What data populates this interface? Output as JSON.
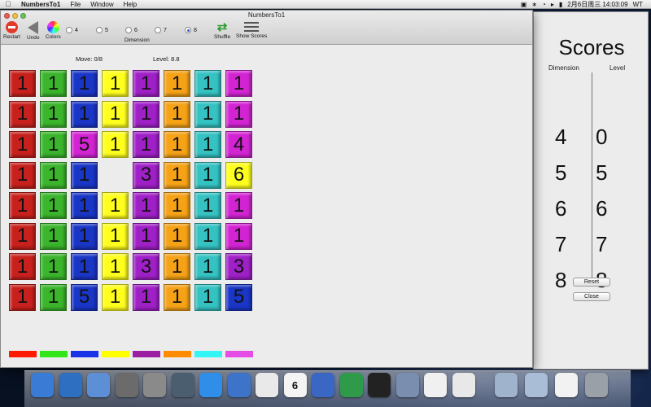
{
  "menubar": {
    "app_name": "NumbersTo1",
    "menus": [
      "File",
      "Window",
      "Help"
    ],
    "clock": "2月6日周三  14:03:09",
    "user": "WT"
  },
  "window": {
    "title": "NumbersTo1",
    "toolbar": {
      "restart": "Restart",
      "undo": "Undo",
      "colors": "Colors",
      "dimension_label": "Dimension",
      "shuffle": "Shuffle",
      "show_scores": "Show Scores",
      "dimension_options": [
        "4",
        "5",
        "6",
        "7",
        "8"
      ],
      "selected_dimension": "8"
    },
    "status": {
      "move": "Move: 0/8",
      "level": "Level: 8.8"
    },
    "board": {
      "column_colors": [
        "#c8211d",
        "#3bb52c",
        "#1a36c7",
        "#ffff1e",
        "#a020c8",
        "#f5a217",
        "#35c2c2",
        "#d324d3"
      ],
      "rows": [
        [
          "1",
          "1",
          "1",
          "1",
          "1",
          "1",
          "1",
          "1"
        ],
        [
          "1",
          "1",
          "1",
          "1",
          "1",
          "1",
          "1",
          "1"
        ],
        [
          "1",
          "1",
          "5",
          "1",
          "1",
          "1",
          "1",
          "4"
        ],
        [
          "1",
          "1",
          "1",
          "",
          "3",
          "1",
          "1",
          "6"
        ],
        [
          "1",
          "1",
          "1",
          "1",
          "1",
          "1",
          "1",
          "1"
        ],
        [
          "1",
          "1",
          "1",
          "1",
          "1",
          "1",
          "1",
          "1"
        ],
        [
          "1",
          "1",
          "1",
          "1",
          "3",
          "1",
          "1",
          "3"
        ],
        [
          "1",
          "1",
          "5",
          "1",
          "1",
          "1",
          "1",
          "5"
        ]
      ],
      "cell_colors": [
        [
          "#c8211d",
          "#3bb52c",
          "#1a36c7",
          "#ffff1e",
          "#a020c8",
          "#f5a217",
          "#35c2c2",
          "#d324d3"
        ],
        [
          "#c8211d",
          "#3bb52c",
          "#1a36c7",
          "#ffff1e",
          "#a020c8",
          "#f5a217",
          "#35c2c2",
          "#d324d3"
        ],
        [
          "#c8211d",
          "#3bb52c",
          "#d324d3",
          "#ffff1e",
          "#a020c8",
          "#f5a217",
          "#35c2c2",
          "#d324d3"
        ],
        [
          "#c8211d",
          "#3bb52c",
          "#1a36c7",
          "",
          "#a020c8",
          "#f5a217",
          "#35c2c2",
          "#ffff1e"
        ],
        [
          "#c8211d",
          "#3bb52c",
          "#1a36c7",
          "#ffff1e",
          "#a020c8",
          "#f5a217",
          "#35c2c2",
          "#d324d3"
        ],
        [
          "#c8211d",
          "#3bb52c",
          "#1a36c7",
          "#ffff1e",
          "#a020c8",
          "#f5a217",
          "#35c2c2",
          "#d324d3"
        ],
        [
          "#c8211d",
          "#3bb52c",
          "#1a36c7",
          "#ffff1e",
          "#a020c8",
          "#f5a217",
          "#35c2c2",
          "#a020c8"
        ],
        [
          "#c8211d",
          "#3bb52c",
          "#1a36c7",
          "#ffff1e",
          "#a020c8",
          "#f5a217",
          "#35c2c2",
          "#1a36c7"
        ]
      ],
      "swatch_colors": [
        "#ff1a00",
        "#33e61a",
        "#1a33e6",
        "#ffff00",
        "#9b1fa3",
        "#ff8c00",
        "#33f5f5",
        "#e64de6"
      ]
    }
  },
  "scores": {
    "title": "Scores",
    "col_dimension": "Dimension",
    "col_level": "Level",
    "dimensions": [
      "4",
      "5",
      "6",
      "7",
      "8"
    ],
    "levels": [
      "0",
      "5",
      "6",
      "7",
      "8"
    ],
    "reset": "Reset",
    "close": "Close"
  },
  "dock": {
    "icons": [
      "finder-icon",
      "xcode-icon",
      "instruments-icon",
      "launchpad-icon",
      "keychain-icon",
      "preview-icon",
      "app-store-icon",
      "itunes-icon",
      "chrome-icon",
      "calendar-icon",
      "word-icon",
      "excel-icon",
      "qq-icon",
      "photo-icon",
      "textedit-icon",
      "script-icon",
      "folder-icon",
      "folder-icon",
      "zip-icon",
      "trash-icon"
    ],
    "calendar_day": "6"
  }
}
